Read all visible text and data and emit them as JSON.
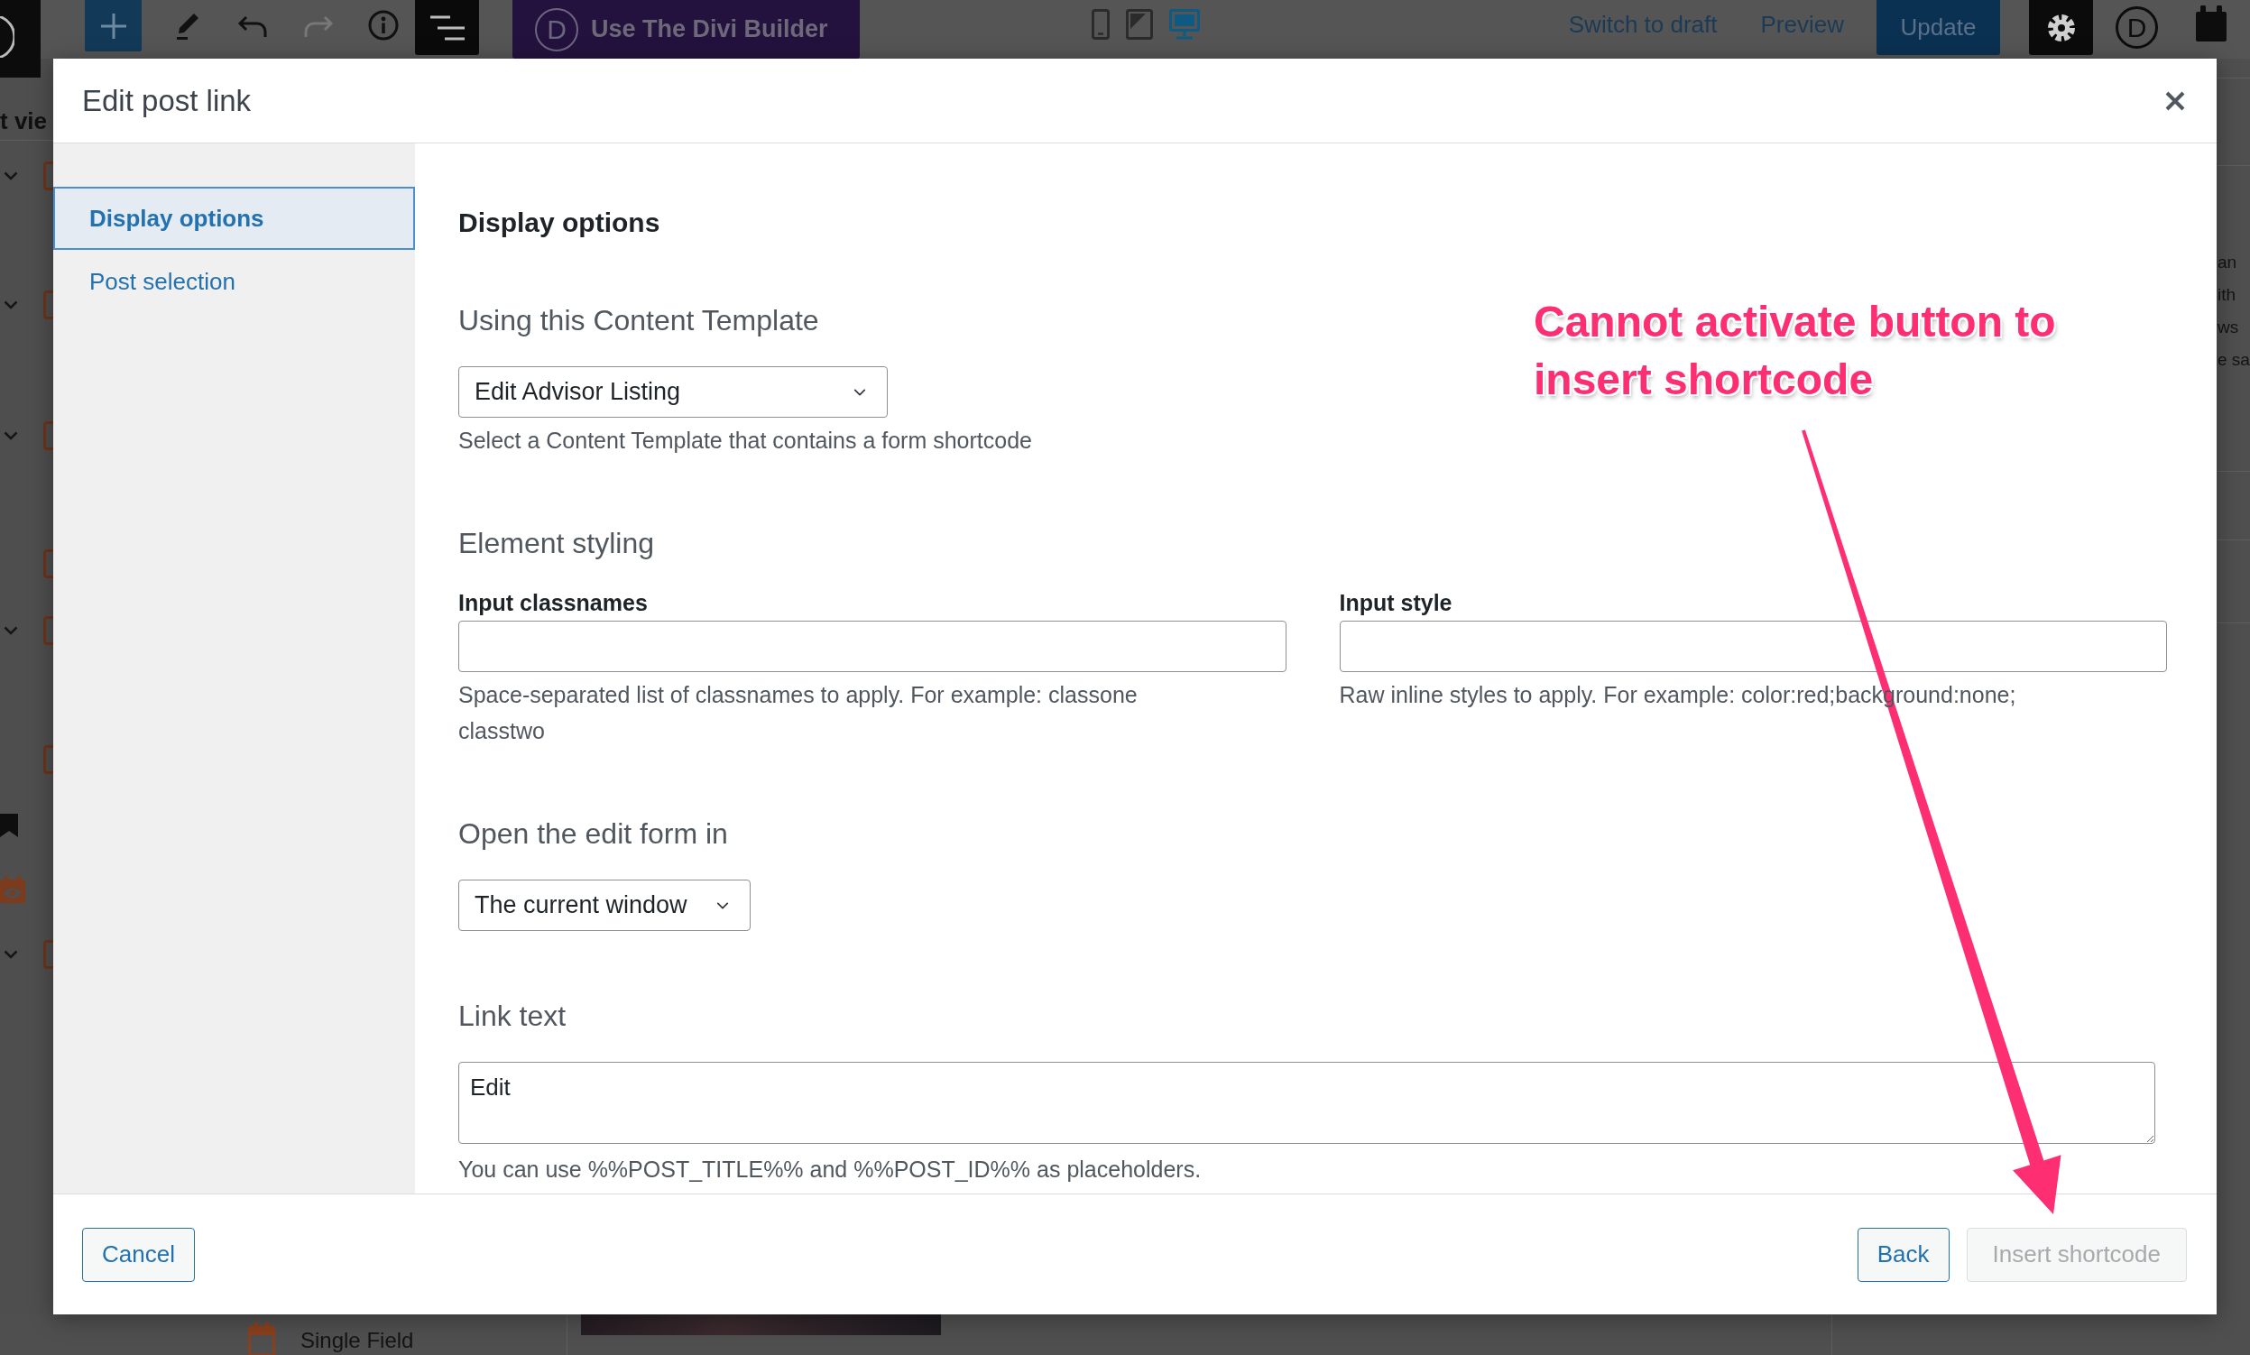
{
  "toolbar": {
    "divi_button": {
      "logo": "D",
      "label": "Use The Divi Builder"
    },
    "devices": [
      {
        "kind": "mobile",
        "selected": false
      },
      {
        "kind": "tablet",
        "selected": false
      },
      {
        "kind": "desktop",
        "selected": true
      }
    ],
    "switch_to_draft": "Switch to draft",
    "preview": "Preview",
    "update": "Update",
    "right_logo": "D"
  },
  "background": {
    "list_view_fragment": "t vie",
    "right_fragments": [
      "an",
      "ith",
      "ws",
      "e sa"
    ],
    "bottom_item": "Single Field"
  },
  "dialog": {
    "title": "Edit post link",
    "tabs": [
      {
        "label": "Display options",
        "selected": true
      },
      {
        "label": "Post selection",
        "selected": false
      }
    ],
    "heading": "Display options",
    "sections": [
      {
        "kind": "select",
        "title": "Using this Content Template",
        "value": "Edit Advisor Listing",
        "help": "Select a Content Template that contains a form shortcode"
      },
      {
        "kind": "pair",
        "title": "Element styling",
        "fields": [
          {
            "label": "Input classnames",
            "help": "Space-separated list of classnames to apply. For example: classone classtwo"
          },
          {
            "label": "Input style",
            "help": "Raw inline styles to apply. For example: color:red;background:none;"
          }
        ]
      },
      {
        "kind": "select",
        "title": "Open the edit form in",
        "value": "The current window"
      },
      {
        "kind": "textarea",
        "title": "Link text",
        "value": "Edit",
        "help": "You can use %%POST_TITLE%% and %%POST_ID%% as placeholders."
      }
    ],
    "footer": {
      "cancel": "Cancel",
      "back": "Back",
      "insert": {
        "label": "Insert shortcode",
        "disabled": true
      }
    }
  },
  "annotation": {
    "text": "Cannot activate button to insert shortcode"
  }
}
